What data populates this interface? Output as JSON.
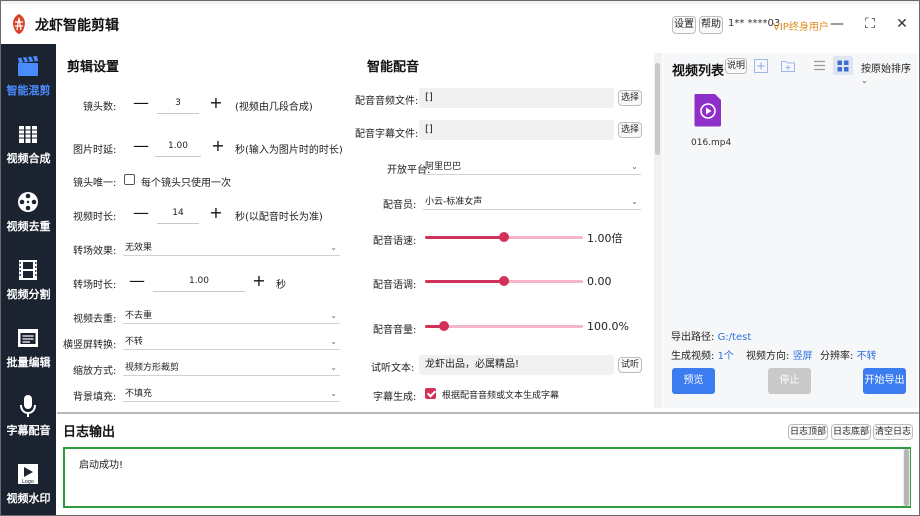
{
  "app": {
    "title": "龙虾智能剪辑",
    "settings_btn": "设置",
    "help_btn": "帮助",
    "account": "1**  ****03",
    "vip": "VIP终身用户",
    "minimize": "—",
    "maximize": "⛶",
    "close": "✕"
  },
  "sidebar": {
    "items": [
      {
        "label": "智能混剪",
        "icon": "clapperboard-icon"
      },
      {
        "label": "视频合成",
        "icon": "film-stack-icon"
      },
      {
        "label": "视频去重",
        "icon": "film-reel-icon"
      },
      {
        "label": "视频分割",
        "icon": "film-strip-icon"
      },
      {
        "label": "批量编辑",
        "icon": "batch-edit-icon"
      },
      {
        "label": "字幕配音",
        "icon": "microphone-icon"
      },
      {
        "label": "视频水印",
        "icon": "logo-watermark-icon"
      }
    ],
    "active": 0,
    "watermark_badge": "Logo"
  },
  "edit": {
    "title": "剪辑设置",
    "shot_count": {
      "label": "镜头数:",
      "value": "3",
      "hint": "(视频由几段合成)"
    },
    "image_delay": {
      "label": "图片时延:",
      "value": "1.00",
      "hint": "秒(输入为图片时的时长)"
    },
    "unique": {
      "label": "镜头唯一:",
      "option": "每个镜头只使用一次",
      "checked": false
    },
    "video_length": {
      "label": "视频时长:",
      "value": "14",
      "hint": "秒(以配音时长为准)"
    },
    "transition": {
      "label": "转场效果:",
      "value": "无效果"
    },
    "transition_len": {
      "label": "转场时长:",
      "value": "1.00",
      "unit": "秒"
    },
    "dedup": {
      "label": "视频去重:",
      "value": "不去重"
    },
    "orient": {
      "label": "横竖屏转换:",
      "value": "不转"
    },
    "scale": {
      "label": "缩放方式:",
      "value": "视频方形裁剪"
    },
    "bg_fill": {
      "label": "背景填充:",
      "value": "不填充"
    },
    "minus": "—",
    "plus": "+"
  },
  "voice": {
    "title": "智能配音",
    "audio_file": {
      "label": "配音音频文件:",
      "value": "[]",
      "btn": "选择"
    },
    "subtitle_file": {
      "label": "配音字幕文件:",
      "value": "[]",
      "btn": "选择"
    },
    "platform": {
      "label": "开放平台:",
      "value": "阿里巴巴"
    },
    "speaker": {
      "label": "配音员:",
      "value": "小云-标准女声"
    },
    "speed": {
      "label": "配音语速:",
      "value": "1.00倍",
      "fraction": 0.5
    },
    "pitch": {
      "label": "配音语调:",
      "value": "0.00",
      "fraction": 0.5
    },
    "volume": {
      "label": "配音音量:",
      "value": "100.0%",
      "fraction": 0.12
    },
    "sample": {
      "label": "试听文本:",
      "value": "龙虾出品，必属精品!",
      "btn": "试听"
    },
    "subtitle_gen": {
      "label": "字幕生成:",
      "option": "根据配音音频或文本生成字幕",
      "checked": true
    }
  },
  "videolist": {
    "title": "视频列表",
    "help": "说明",
    "sort": "按原始排序",
    "files": [
      {
        "name": "016.mp4"
      }
    ],
    "export_path_label": "导出路径:",
    "export_path": "G:/test",
    "gen_count_label": "生成视频:",
    "gen_count": "1个",
    "direction_label": "视频方向:",
    "direction": "竖屏",
    "resolution_label": "分辨率:",
    "resolution": "不转",
    "preview_btn": "预览",
    "stop_btn": "停止",
    "export_btn": "开始导出",
    "colors": {
      "accent": "#3b7cf0",
      "stop": "#c9c9c9",
      "file_icon": "#8e2fc9"
    }
  },
  "log": {
    "title": "日志输出",
    "top_btn": "日志顶部",
    "bottom_btn": "日志底部",
    "clear_btn": "清空日志",
    "text": "启动成功!",
    "border_color": "#2e9b3e"
  }
}
